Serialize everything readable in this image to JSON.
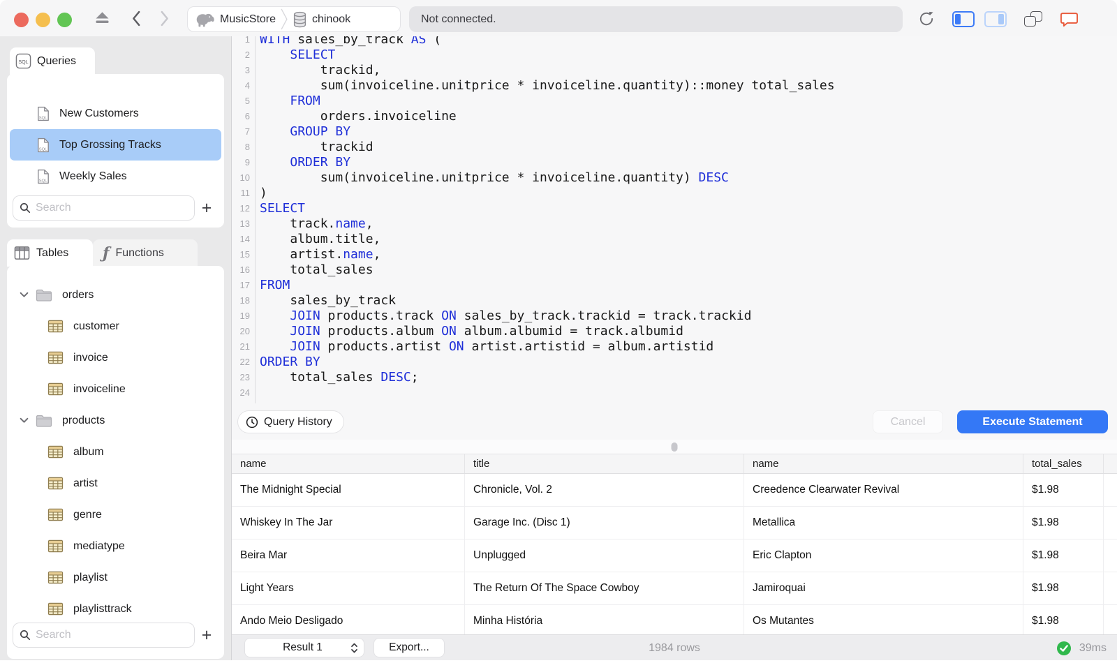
{
  "titlebar": {
    "breadcrumb": {
      "server": "MusicStore",
      "database": "chinook"
    },
    "status": "Not connected."
  },
  "sidebar": {
    "queries_tab": "Queries",
    "sql_badge": "SQL",
    "query_items": [
      {
        "label": "New Customers",
        "selected": false
      },
      {
        "label": "Top Grossing Tracks",
        "selected": true
      },
      {
        "label": "Weekly Sales",
        "selected": false
      }
    ],
    "query_search_placeholder": "Search",
    "tables_tab": "Tables",
    "functions_tab": "Functions",
    "functions_glyph": "ƒ",
    "add_button": "+",
    "tree": [
      {
        "type": "folder",
        "label": "orders"
      },
      {
        "type": "table",
        "label": "customer"
      },
      {
        "type": "table",
        "label": "invoice"
      },
      {
        "type": "table",
        "label": "invoiceline"
      },
      {
        "type": "folder",
        "label": "products"
      },
      {
        "type": "table",
        "label": "album"
      },
      {
        "type": "table",
        "label": "artist"
      },
      {
        "type": "table",
        "label": "genre"
      },
      {
        "type": "table",
        "label": "mediatype"
      },
      {
        "type": "table",
        "label": "playlist"
      },
      {
        "type": "table",
        "label": "playlisttrack"
      }
    ],
    "table_search_placeholder": "Search"
  },
  "editor": {
    "lines": [
      {
        "n": "1",
        "segs": [
          {
            "t": "WITH",
            "k": true
          },
          {
            "t": " sales_by_track "
          },
          {
            "t": "AS",
            "k": true
          },
          {
            "t": " ("
          }
        ]
      },
      {
        "n": "2",
        "segs": [
          {
            "t": "    "
          },
          {
            "t": "SELECT",
            "k": true
          }
        ]
      },
      {
        "n": "3",
        "segs": [
          {
            "t": "        trackid,"
          }
        ]
      },
      {
        "n": "4",
        "segs": [
          {
            "t": "        sum(invoiceline.unitprice * invoiceline.quantity)::money total_sales"
          }
        ]
      },
      {
        "n": "5",
        "segs": [
          {
            "t": "    "
          },
          {
            "t": "FROM",
            "k": true
          }
        ]
      },
      {
        "n": "6",
        "segs": [
          {
            "t": "        orders.invoiceline"
          }
        ]
      },
      {
        "n": "7",
        "segs": [
          {
            "t": "    "
          },
          {
            "t": "GROUP BY",
            "k": true
          }
        ]
      },
      {
        "n": "8",
        "segs": [
          {
            "t": "        trackid"
          }
        ]
      },
      {
        "n": "9",
        "segs": [
          {
            "t": "    "
          },
          {
            "t": "ORDER BY",
            "k": true
          }
        ]
      },
      {
        "n": "10",
        "segs": [
          {
            "t": "        sum(invoiceline.unitprice * invoiceline.quantity) "
          },
          {
            "t": "DESC",
            "k": true
          }
        ]
      },
      {
        "n": "11",
        "segs": [
          {
            "t": ")"
          }
        ]
      },
      {
        "n": "12",
        "segs": [
          {
            "t": "SELECT",
            "k": true
          }
        ]
      },
      {
        "n": "13",
        "segs": [
          {
            "t": "    track."
          },
          {
            "t": "name",
            "k": true
          },
          {
            "t": ","
          }
        ]
      },
      {
        "n": "14",
        "segs": [
          {
            "t": "    album.title,"
          }
        ]
      },
      {
        "n": "15",
        "segs": [
          {
            "t": "    artist."
          },
          {
            "t": "name",
            "k": true
          },
          {
            "t": ","
          }
        ]
      },
      {
        "n": "16",
        "segs": [
          {
            "t": "    total_sales"
          }
        ]
      },
      {
        "n": "17",
        "segs": [
          {
            "t": "FROM",
            "k": true
          }
        ]
      },
      {
        "n": "18",
        "segs": [
          {
            "t": "    sales_by_track"
          }
        ]
      },
      {
        "n": "19",
        "segs": [
          {
            "t": "    "
          },
          {
            "t": "JOIN",
            "k": true
          },
          {
            "t": " products.track "
          },
          {
            "t": "ON",
            "k": true
          },
          {
            "t": " sales_by_track.trackid = track.trackid"
          }
        ]
      },
      {
        "n": "20",
        "segs": [
          {
            "t": "    "
          },
          {
            "t": "JOIN",
            "k": true
          },
          {
            "t": " products.album "
          },
          {
            "t": "ON",
            "k": true
          },
          {
            "t": " album.albumid = track.albumid"
          }
        ]
      },
      {
        "n": "21",
        "segs": [
          {
            "t": "    "
          },
          {
            "t": "JOIN",
            "k": true
          },
          {
            "t": " products.artist "
          },
          {
            "t": "ON",
            "k": true
          },
          {
            "t": " artist.artistid = album.artistid"
          }
        ]
      },
      {
        "n": "22",
        "segs": [
          {
            "t": "ORDER BY",
            "k": true
          }
        ]
      },
      {
        "n": "23",
        "segs": [
          {
            "t": "    total_sales "
          },
          {
            "t": "DESC",
            "k": true
          },
          {
            "t": ";"
          }
        ]
      },
      {
        "n": "24",
        "segs": []
      }
    ],
    "query_history_label": "Query History",
    "cancel_label": "Cancel",
    "execute_label": "Execute Statement"
  },
  "results": {
    "columns": [
      "name",
      "title",
      "name",
      "total_sales"
    ],
    "rows": [
      [
        "The Midnight Special",
        "Chronicle, Vol. 2",
        "Creedence Clearwater Revival",
        "$1.98"
      ],
      [
        "Whiskey In The Jar",
        "Garage Inc. (Disc 1)",
        "Metallica",
        "$1.98"
      ],
      [
        "Beira Mar",
        "Unplugged",
        "Eric Clapton",
        "$1.98"
      ],
      [
        "Light Years",
        "The Return Of The Space Cowboy",
        "Jamiroquai",
        "$1.98"
      ],
      [
        "Ando Meio Desligado",
        "Minha História",
        "Os Mutantes",
        "$1.98"
      ]
    ]
  },
  "statusbar": {
    "result_selector": "Result 1",
    "export_label": "Export...",
    "row_count": "1984 rows",
    "duration": "39ms"
  },
  "colors": {
    "accent_blue": "#3478F6",
    "keyword_blue": "#1F2FD8",
    "selection_blue": "#A8CCF8",
    "status_green": "#30B84C",
    "bubble_orange": "#E8593A"
  }
}
